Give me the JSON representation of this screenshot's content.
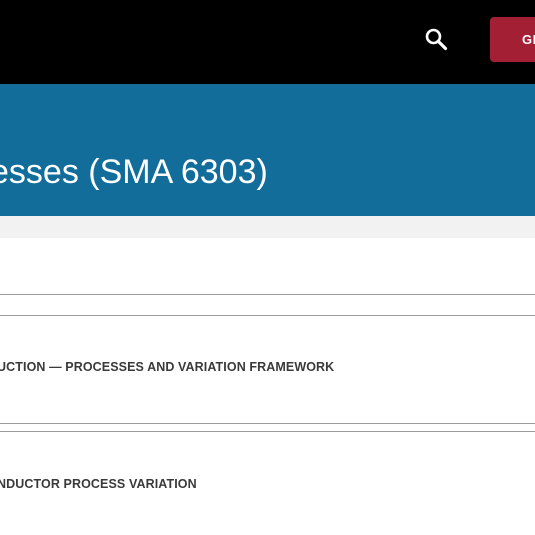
{
  "header": {
    "search_icon": "search-icon",
    "give_button_label": "GIVE",
    "give_button_color": "#a31f34",
    "background": "#000000"
  },
  "banner": {
    "title": "esses (SMA 6303)",
    "background": "#126d9a"
  },
  "sections": [
    {
      "label": "UCTION — PROCESSES AND VARIATION FRAMEWORK"
    },
    {
      "label": "NDUCTOR PROCESS VARIATION"
    }
  ]
}
